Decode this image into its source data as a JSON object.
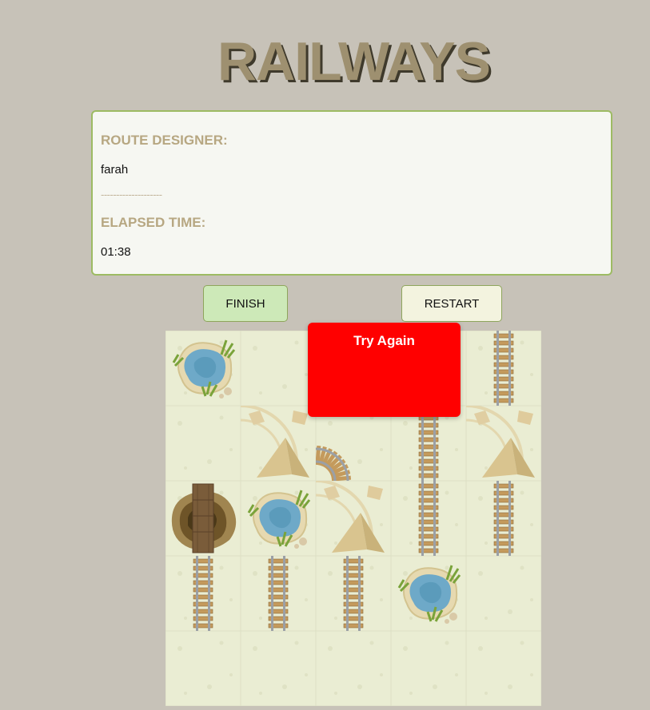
{
  "header": {
    "title": "RAILWAYS"
  },
  "info": {
    "designer_label": "ROUTE DESIGNER:",
    "designer_name": "farah",
    "separator": "--------------------",
    "time_label": "ELAPSED TIME:",
    "time_value": "01:38"
  },
  "controls": {
    "finish_label": "FINISH",
    "restart_label": "RESTART"
  },
  "popup": {
    "message": "Try Again"
  },
  "board": {
    "rows": [
      [
        "oasis",
        "empty",
        "empty",
        "empty",
        "straight-vertical"
      ],
      [
        "empty",
        "mountain",
        "curve",
        "straight-vertical",
        "mountain"
      ],
      [
        "bridge",
        "oasis",
        "mountain",
        "straight-vertical",
        "straight-vertical"
      ],
      [
        "straight-vertical",
        "straight-vertical",
        "straight-vertical",
        "oasis",
        "empty"
      ],
      [
        "empty",
        "empty",
        "empty",
        "empty",
        "empty"
      ]
    ]
  },
  "colors": {
    "background": "#c7c2b8",
    "board": "#eaedd3",
    "popup": "#ff0000",
    "finish": "#cde9b8",
    "restart": "#f3f3df"
  }
}
